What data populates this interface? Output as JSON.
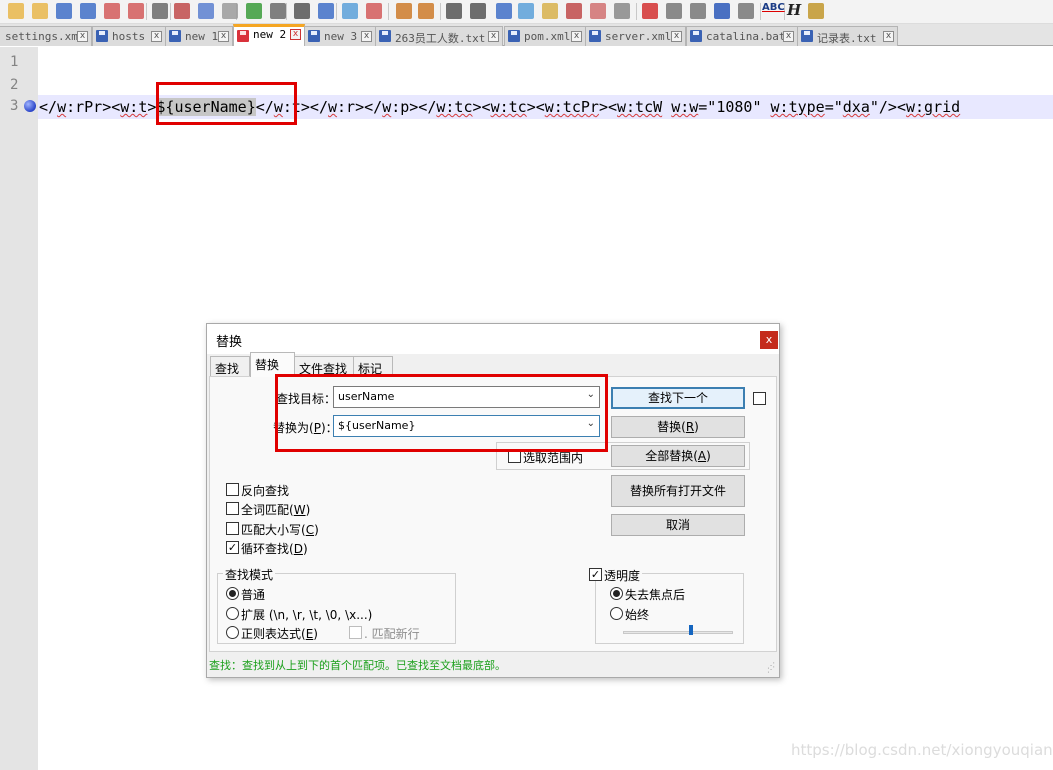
{
  "toolbar": {
    "icons": [
      "new-file-icon",
      "open-file-icon",
      "save-icon",
      "save-all-icon",
      "close-icon",
      "close-all-icon",
      "print-icon",
      "cut-icon",
      "copy-icon",
      "paste-icon",
      "undo-icon",
      "redo-icon",
      "find-icon",
      "replace-icon",
      "zoom-in-icon",
      "zoom-out-icon",
      "sync-vertical-icon",
      "sync-horizontal-icon",
      "word-wrap-icon",
      "show-all-chars-icon",
      "indent-guide-icon",
      "doc-map-icon",
      "function-list-icon",
      "folder-workspace-icon",
      "monitoring-icon",
      "record-macro-icon",
      "stop-macro-icon",
      "play-macro-icon",
      "run-macro-icon",
      "save-macro-icon",
      "spell-check-icon",
      "header-icon",
      "launch-icon"
    ],
    "spell_label": "ABC",
    "h_label": "H"
  },
  "tabs": [
    {
      "label": "settings.xml"
    },
    {
      "label": "hosts"
    },
    {
      "label": "new 1"
    },
    {
      "label": "new 2"
    },
    {
      "label": "new 3"
    },
    {
      "label": "263员工人数.txt"
    },
    {
      "label": "pom.xml"
    },
    {
      "label": "server.xml"
    },
    {
      "label": "catalina.bat"
    },
    {
      "label": "记录表.txt"
    }
  ],
  "active_tab": "new 2",
  "editor": {
    "line_numbers": [
      "1",
      "2",
      "3"
    ],
    "line3": {
      "seg1": "</",
      "seg2": "w",
      "seg3": ":rPr><",
      "seg4": "w:t",
      "seg5": ">",
      "highlight": "${userName}",
      "seg6": "</",
      "seg7": "w",
      "seg8": ":t></",
      "seg9": "w",
      "seg10": ":r></",
      "seg11": "w",
      "seg12": ":p></",
      "seg13": "w:tc",
      "seg14": "><",
      "seg15": "w:tc",
      "seg16": "><",
      "seg17": "w:tcPr",
      "seg18": "><",
      "seg19": "w:tcW",
      "seg20": " ",
      "seg21": "w:w",
      "seg22": "=\"1080\" ",
      "seg23": "w:type",
      "seg24": "=\"",
      "seg25": "dxa",
      "seg26": "\"/><",
      "seg27": "w:grid"
    }
  },
  "dialog": {
    "title": "替换",
    "close_glyph": "x",
    "tabs": [
      "查找",
      "替换",
      "文件查找",
      "标记"
    ],
    "active_tab": "替换",
    "find_label": "查找目标：",
    "find_value": "userName",
    "replace_label_pre": "替换为(",
    "replace_label_key": "P",
    "replace_label_post": ")：",
    "replace_value": "${userName}",
    "in_selection": "选取范围内",
    "buttons": {
      "find_next": "查找下一个",
      "replace_pre": "替换(",
      "replace_key": "R",
      "replace_post": ")",
      "replace_all_pre": "全部替换(",
      "replace_all_key": "A",
      "replace_all_post": ")",
      "replace_all_open": "替换所有打开文件",
      "cancel": "取消"
    },
    "options": [
      {
        "pre": "反向查找",
        "key": "",
        "post": "",
        "checked": false
      },
      {
        "pre": "全词匹配(",
        "key": "W",
        "post": ")",
        "checked": false
      },
      {
        "pre": "匹配大小写(",
        "key": "C",
        "post": ")",
        "checked": false
      },
      {
        "pre": "循环查找(",
        "key": "D",
        "post": ")",
        "checked": true
      }
    ],
    "check_mark": "✓",
    "search_mode": {
      "title": "查找模式",
      "normal": "普通",
      "extended": "扩展 (\\n, \\r, \\t, \\0, \\x...)",
      "regex_pre": "正则表达式(",
      "regex_key": "E",
      "regex_post": ")",
      "match_newline": ". 匹配新行",
      "selected": "普通"
    },
    "transparency": {
      "title": "透明度",
      "checked": true,
      "on_lose_focus": "失去焦点后",
      "always": "始终",
      "selected": "失去焦点后",
      "level": 0.62
    },
    "status": "查找：查找到从上到下的首个匹配项。已查找至文档最底部。"
  },
  "watermark": "https://blog.csdn.net/xiongyouqiang",
  "colors": {
    "highlight_box": "#e00000",
    "status_text": "#1a9f1a",
    "current_line": "#e8e8ff",
    "active_tab_accent": "#f5a623"
  }
}
